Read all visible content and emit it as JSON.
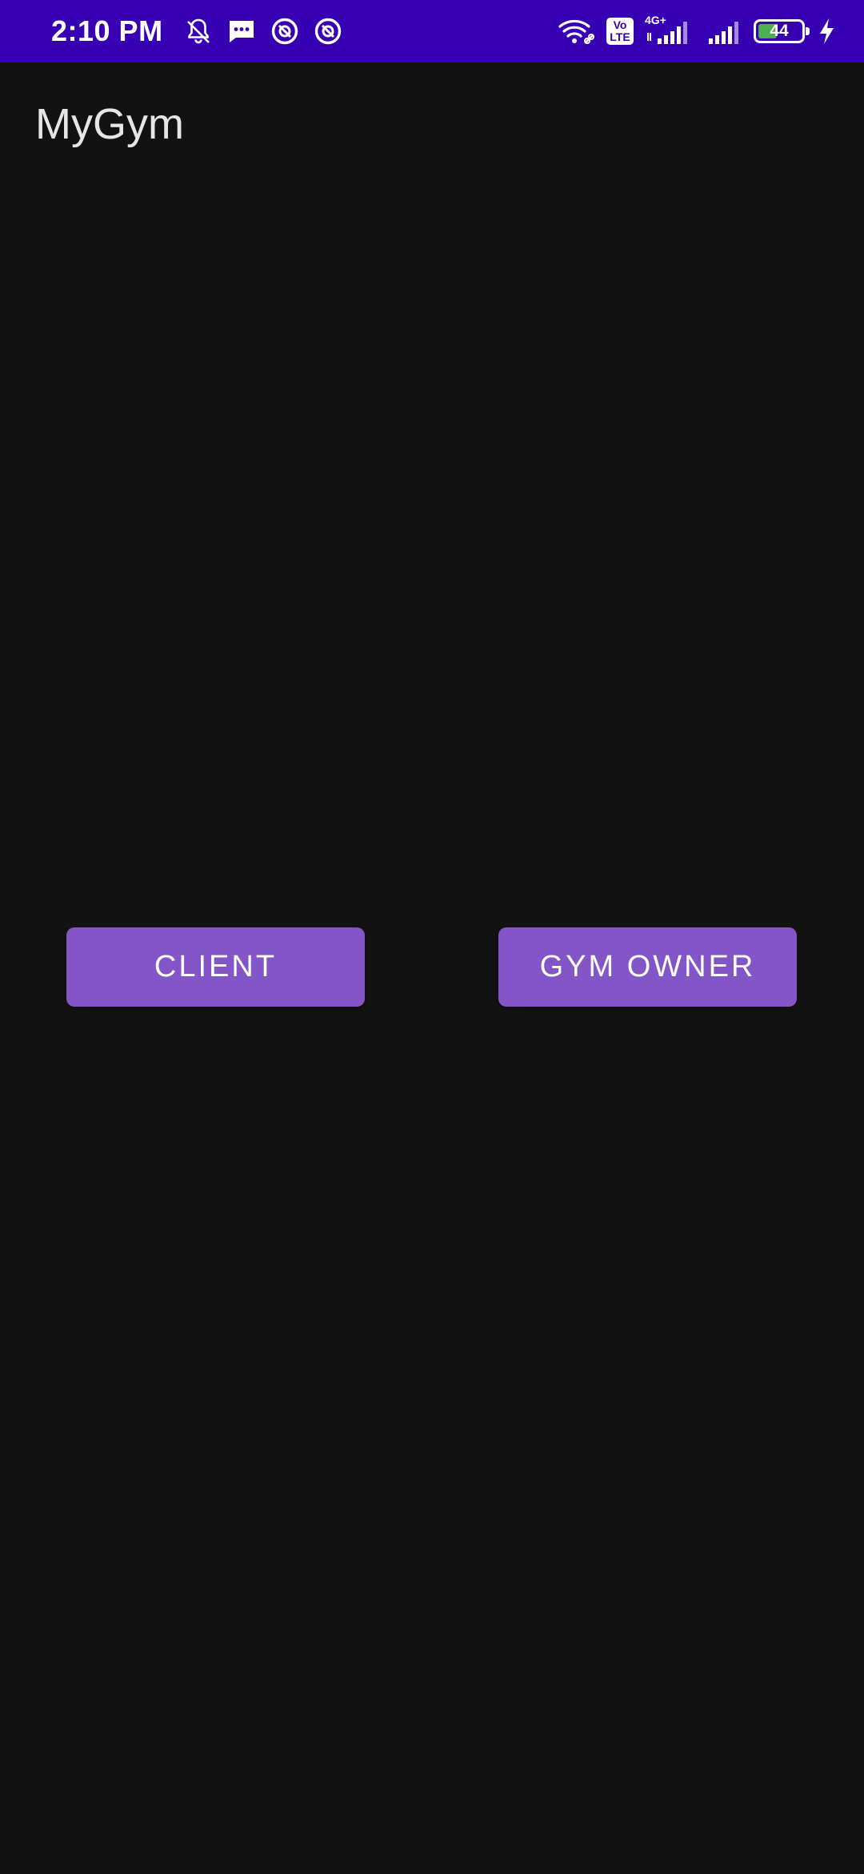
{
  "status_bar": {
    "time": "2:10 PM",
    "volte_label_top": "Vo",
    "volte_label_bottom": "LTE",
    "network_type": "4G+",
    "battery_level": "44",
    "battery_fraction": 0.44,
    "background_color": "#3700b3",
    "icons": [
      "muted-bell-icon",
      "sms-icon",
      "app-notification-icon",
      "app-notification-icon",
      "wifi-icon",
      "volte-icon",
      "signal-icon",
      "signal-icon",
      "battery-icon",
      "charging-icon"
    ]
  },
  "app": {
    "title": "MyGym"
  },
  "main": {
    "client_button_label": "CLIENT",
    "gym_owner_button_label": "GYM OWNER",
    "button_color": "#8355c6"
  }
}
